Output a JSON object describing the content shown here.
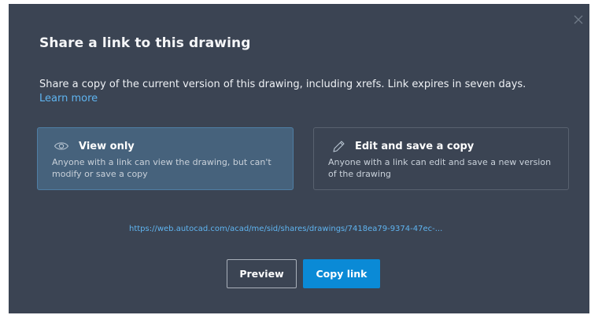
{
  "dialog": {
    "title": "Share a link to this drawing",
    "description": "Share a copy of the current version of this drawing, including xrefs. Link expires in seven days.",
    "learn_more_label": "Learn more",
    "close_icon": "close-icon",
    "options": [
      {
        "id": "view-only",
        "icon": "eye-icon",
        "title": "View only",
        "description": "Anyone with a link can view the drawing, but can't modify or save a copy",
        "selected": true
      },
      {
        "id": "edit-save-copy",
        "icon": "pencil-icon",
        "title": "Edit and save a copy",
        "description": "Anyone with a link can edit and save a new version of the drawing",
        "selected": false
      }
    ],
    "share_link": "https://web.autocad.com/acad/me/sid/shares/drawings/7418ea79-9374-47ec-...",
    "buttons": {
      "preview_label": "Preview",
      "copy_link_label": "Copy link"
    }
  },
  "colors": {
    "dialog_background": "#3b4453",
    "selected_card_background": "#46627c",
    "selected_card_border": "#4f7ea4",
    "link": "#5fb4f0",
    "primary_button": "#0a8ad6"
  }
}
